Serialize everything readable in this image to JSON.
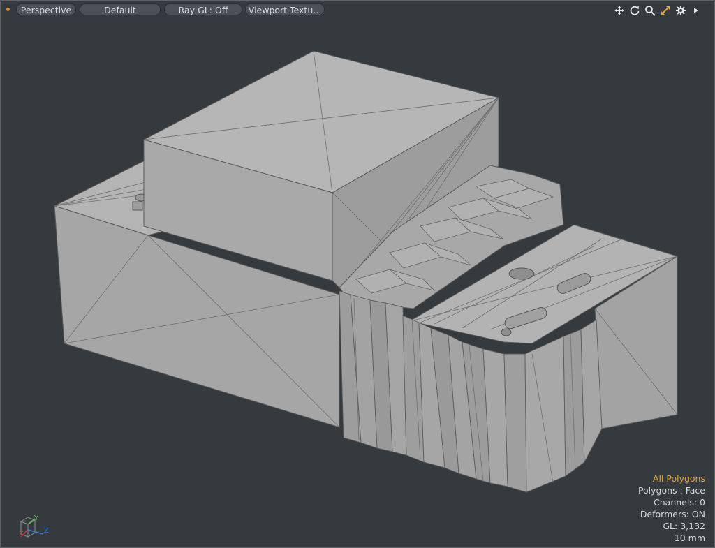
{
  "toolbar": {
    "view_mode": "Perspective",
    "shading": "Default",
    "ray_gl": "Ray GL: Off",
    "viewport_textures": "Viewport Textu..."
  },
  "tools": [
    "move-view-icon",
    "rotate-view-icon",
    "zoom-view-icon",
    "maximize-viewport-icon",
    "viewport-settings-icon",
    "expand-menu-icon"
  ],
  "info": {
    "selection": "All Polygons",
    "polygons": "Polygons : Face",
    "channels": "Channels: 0",
    "deformers": "Deformers: ON",
    "gl": "GL: 3,132",
    "grid": "10 mm"
  },
  "axes": {
    "y": "Y",
    "z": "Z",
    "x": "X"
  },
  "colors": {
    "background": "#343a3e",
    "accent": "#e6a83a",
    "mesh": "#a3a3a3"
  }
}
